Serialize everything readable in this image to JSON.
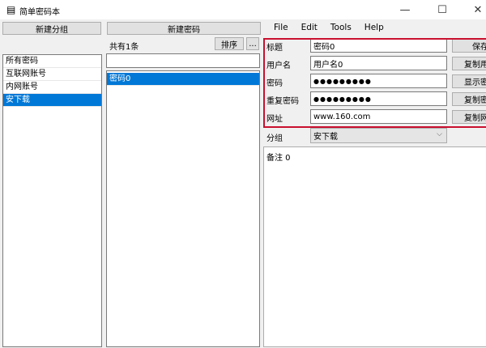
{
  "window": {
    "title": "简单密码本",
    "icon": "notebook-icon",
    "controls": [
      "minimize-icon",
      "maximize-icon",
      "close-icon"
    ]
  },
  "groups": {
    "new_group_label": "新建分组",
    "items": [
      {
        "label": "所有密码"
      },
      {
        "label": "互联网账号"
      },
      {
        "label": "内网账号"
      },
      {
        "label": "安下载",
        "selected": true
      }
    ]
  },
  "passwords": {
    "new_password_label": "新建密码",
    "count_text": "共有1条",
    "sort_label": "排序",
    "more_label": "...",
    "search_value": "",
    "items": [
      {
        "label": "密码0",
        "selected": true
      }
    ]
  },
  "menu": [
    "File",
    "Edit",
    "Tools",
    "Help"
  ],
  "form": {
    "fields": [
      {
        "label": "标题",
        "value": "密码0",
        "button": "保存"
      },
      {
        "label": "用户名",
        "value": "用户名0",
        "button": "复制用"
      },
      {
        "label": "密码",
        "value": "●●●●●●●●●",
        "button": "显示密"
      },
      {
        "label": "重复密码",
        "value": "●●●●●●●●●",
        "button": "复制密"
      },
      {
        "label": "网址",
        "value": "www.160.com",
        "button": "复制网"
      }
    ],
    "group_label": "分组",
    "group_value": "安下载",
    "notes": "备注 0"
  },
  "colors": {
    "selection": "#0078d7",
    "highlight_border": "#c8102e"
  }
}
